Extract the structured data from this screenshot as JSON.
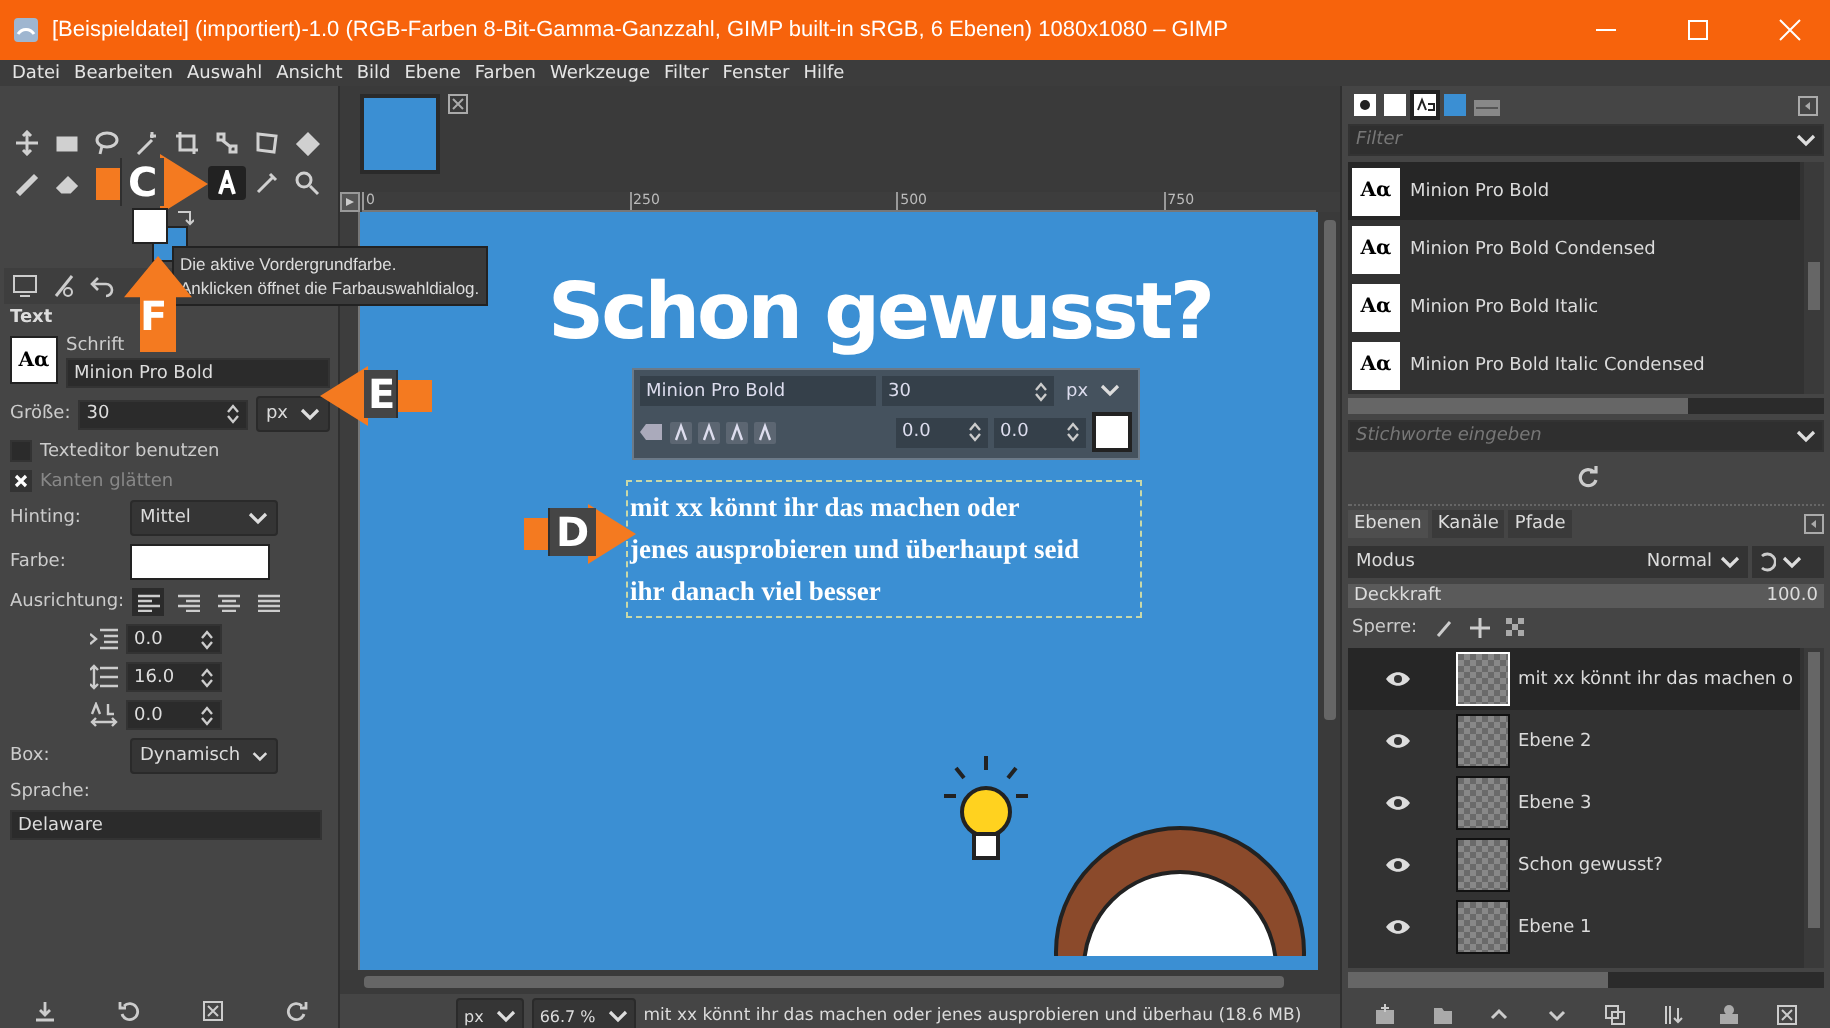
{
  "window": {
    "title": "[Beispieldatei] (importiert)-1.0 (RGB-Farben 8-Bit-Gamma-Ganzzahl, GIMP built-in sRGB, 6 Ebenen) 1080x1080 – GIMP"
  },
  "menu": [
    "Datei",
    "Bearbeiten",
    "Auswahl",
    "Ansicht",
    "Bild",
    "Ebene",
    "Farben",
    "Werkzeuge",
    "Filter",
    "Fenster",
    "Hilfe"
  ],
  "tools": [
    {
      "kind": "move",
      "selected": false
    },
    {
      "kind": "rect-select",
      "selected": false
    },
    {
      "kind": "lasso",
      "selected": false
    },
    {
      "kind": "wand",
      "selected": false
    },
    {
      "kind": "crop",
      "selected": false
    },
    {
      "kind": "transform",
      "selected": false
    },
    {
      "kind": "warp",
      "selected": false
    },
    {
      "kind": "bucket",
      "selected": false
    },
    {
      "kind": "pencil",
      "selected": false
    },
    {
      "kind": "eraser",
      "selected": false
    },
    {
      "kind": "text",
      "selected": true
    },
    {
      "kind": "picker",
      "selected": false
    },
    {
      "kind": "zoom",
      "selected": false
    }
  ],
  "tooltip": [
    "Die aktive Vordergrundfarbe.",
    "Anklicken öffnet die Farbauswahldialog."
  ],
  "tool_options": {
    "title": "Text",
    "font_preview": "Aα",
    "font_label": "Schrift",
    "font": "Minion Pro Bold",
    "size_label": "Größe:",
    "size": "30",
    "unit": "px",
    "checkboxes": [
      {
        "label": "Texteditor benutzen",
        "checked": false,
        "disabled": false
      },
      {
        "label": "Kanten glätten",
        "checked": true,
        "disabled": true
      }
    ],
    "hinting_label": "Hinting:",
    "hinting": "Mittel",
    "color_label": "Farbe:",
    "align_label": "Ausrichtung:",
    "align": [
      {
        "kind": "left",
        "selected": true
      },
      {
        "kind": "right",
        "selected": false
      },
      {
        "kind": "center",
        "selected": false
      },
      {
        "kind": "fill",
        "selected": false
      }
    ],
    "spins": [
      {
        "kind": "indent",
        "value": "0.0"
      },
      {
        "kind": "line-spacing",
        "value": "16.0"
      },
      {
        "kind": "letter-spacing",
        "value": "0.0"
      }
    ],
    "box_label": "Box:",
    "box": "Dynamisch",
    "language_label": "Sprache:",
    "language": "Delaware"
  },
  "ruler_marks": [
    "0",
    "250",
    "500",
    "750"
  ],
  "canvas": {
    "heading": "Schon gewusst?",
    "text_lines": [
      "mit xx könnt ihr das machen oder",
      "jenes ausprobieren und überhaupt seid",
      "ihr danach viel besser"
    ],
    "text_toolbar": {
      "font": "Minion Pro Bold",
      "size": "30",
      "unit": "px",
      "baseline": "0.0",
      "kerning": "0.0"
    }
  },
  "status_bar": {
    "unit": "px",
    "zoom": "66.7 %",
    "message": "mit xx könnt ihr das machen oder jenes ausprobieren und überhau (18.6 MB)"
  },
  "fonts": {
    "filter_placeholder": "Filter",
    "items": [
      {
        "preview": "Aα",
        "name": "Minion Pro Bold",
        "selected": true
      },
      {
        "preview": "Aα",
        "name": "Minion Pro Bold Condensed",
        "selected": false
      },
      {
        "preview": "Aα",
        "name": "Minion Pro Bold Italic",
        "selected": false
      },
      {
        "preview": "Aα",
        "name": "Minion Pro Bold Italic Condensed",
        "selected": false
      }
    ],
    "tags_placeholder": "Stichworte eingeben"
  },
  "dock_tabs": [
    {
      "label": "Ebenen",
      "selected": true
    },
    {
      "label": "Kanäle",
      "selected": false
    },
    {
      "label": "Pfade",
      "selected": false
    }
  ],
  "layers_panel": {
    "mode_label": "Modus",
    "mode": "Normal",
    "opacity_label": "Deckkraft",
    "opacity": "100.0",
    "opacity_level": {
      "level": 1
    },
    "lock_label": "Sperre:",
    "layers": [
      {
        "name": "mit xx könnt ihr das machen o",
        "visible": true,
        "selected": true
      },
      {
        "name": "Ebene 2",
        "visible": true,
        "selected": false
      },
      {
        "name": "Ebene 3",
        "visible": true,
        "selected": false
      },
      {
        "name": "Schon gewusst?",
        "visible": true,
        "selected": false
      },
      {
        "name": "Ebene 1",
        "visible": true,
        "selected": false
      }
    ]
  },
  "callouts": [
    {
      "label": "C",
      "kind": "right"
    },
    {
      "label": "F",
      "kind": "up"
    },
    {
      "label": "E",
      "kind": "left"
    },
    {
      "label": "D",
      "kind": "right"
    }
  ]
}
